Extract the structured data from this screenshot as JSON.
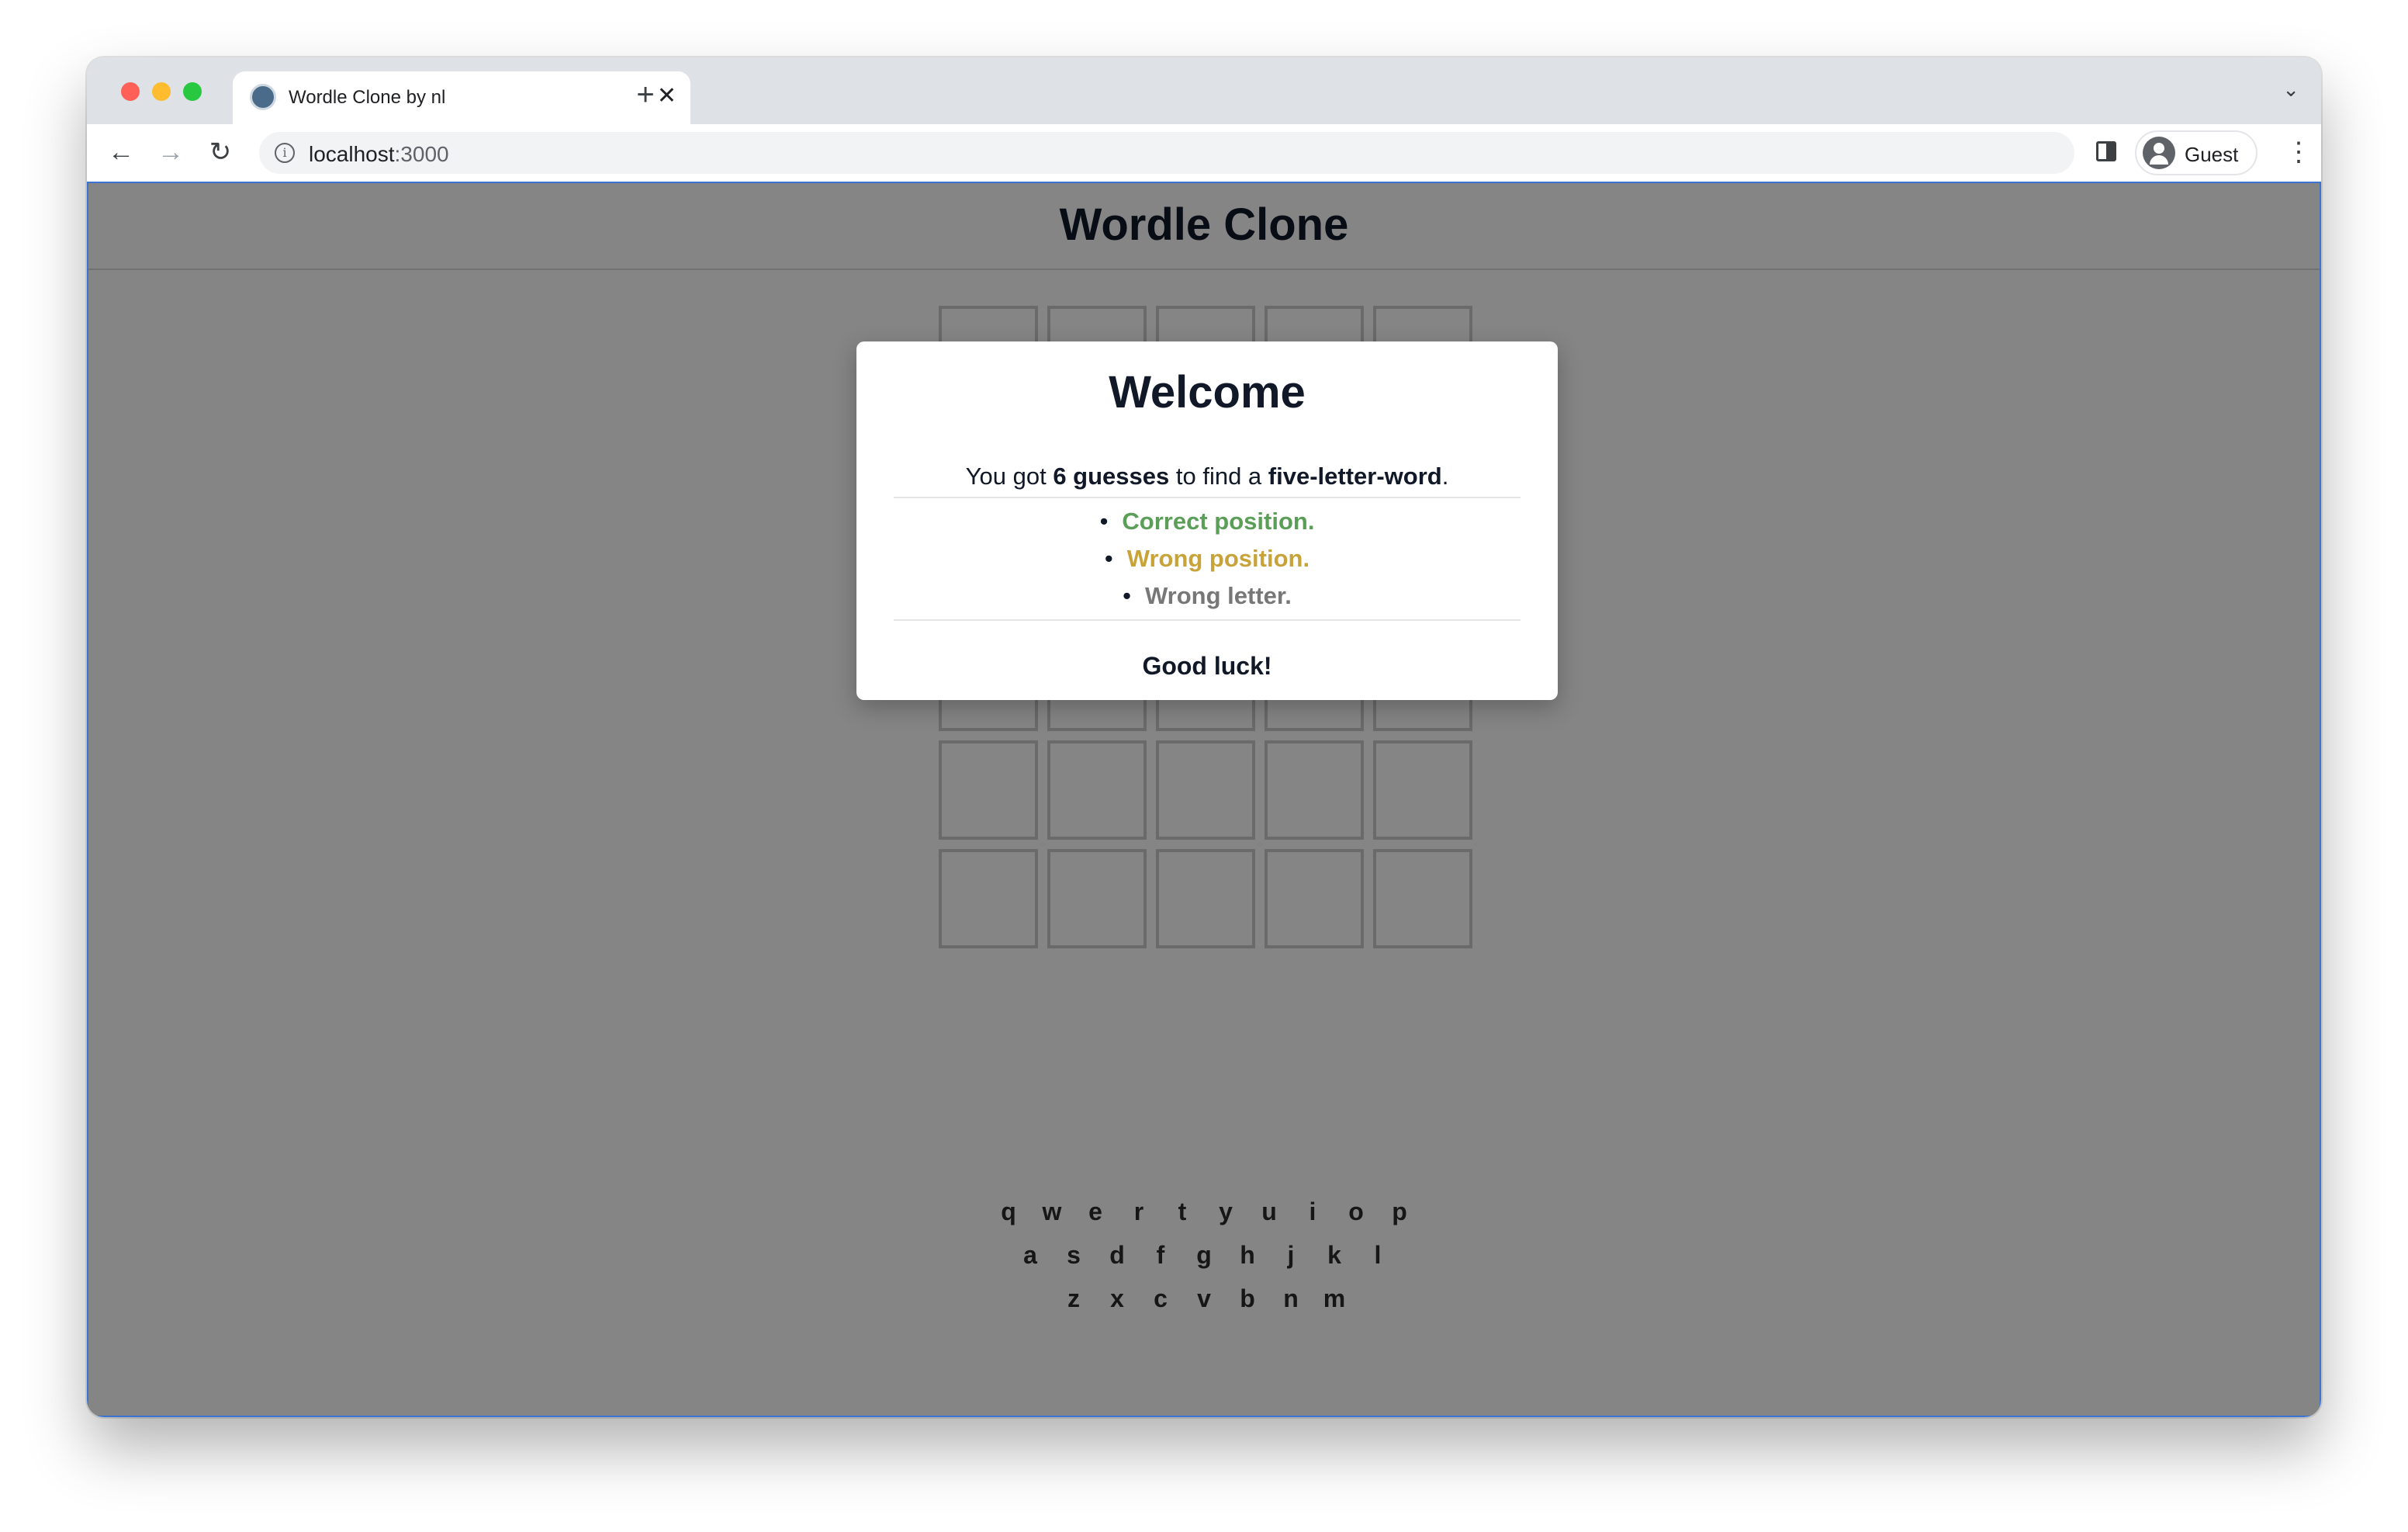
{
  "browser": {
    "tab_title": "Wordle Clone by nl",
    "url_host": "localhost",
    "url_port": ":3000",
    "profile_name": "Guest"
  },
  "app": {
    "title": "Wordle Clone"
  },
  "board": {
    "rows": 6,
    "cols": 5,
    "tiles_visible_rows": 4
  },
  "keyboard": {
    "rows": [
      [
        "q",
        "w",
        "e",
        "r",
        "t",
        "y",
        "u",
        "i",
        "o",
        "p"
      ],
      [
        "a",
        "s",
        "d",
        "f",
        "g",
        "h",
        "j",
        "k",
        "l"
      ],
      [
        "z",
        "x",
        "c",
        "v",
        "b",
        "n",
        "m"
      ]
    ]
  },
  "modal": {
    "title": "Welcome",
    "intro_prefix": "You got ",
    "intro_guesses": "6 guesses",
    "intro_middle": " to find a ",
    "intro_word": "five-letter-word",
    "intro_suffix": ".",
    "rules": {
      "correct": "Correct position.",
      "wrong_position": "Wrong position.",
      "wrong_letter": "Wrong letter."
    },
    "footer": "Good luck!"
  },
  "colors": {
    "correct": "#5a9e58",
    "wrong_position": "#c8a33a",
    "wrong_letter": "#777777",
    "overlay": "rgba(0,0,0,0.48)",
    "focus_border": "#3b73d1"
  }
}
